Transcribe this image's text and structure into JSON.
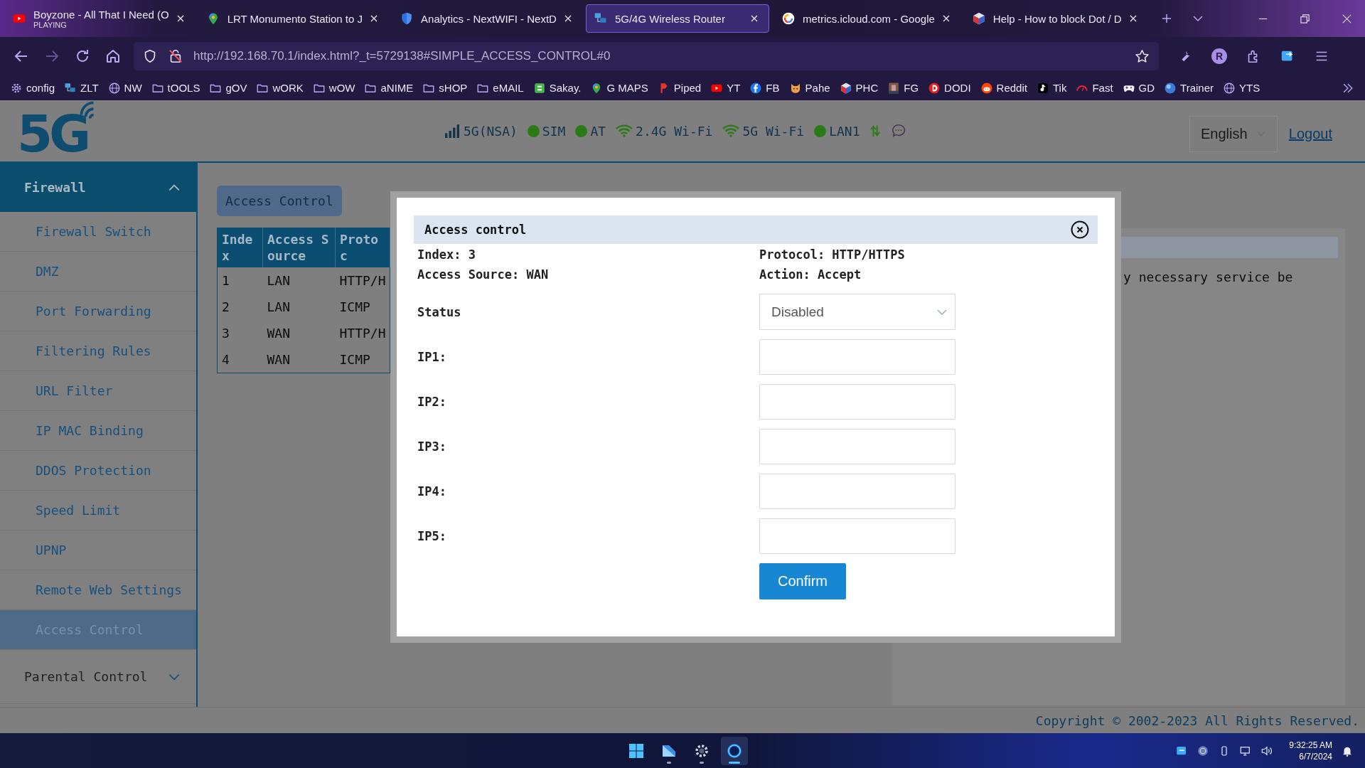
{
  "browser": {
    "tabs": [
      {
        "title": "Boyzone - All That I Need (O",
        "subtitle": "PLAYING",
        "selected": false
      },
      {
        "title": "LRT Monumento Station to J",
        "selected": false
      },
      {
        "title": "Analytics - NextWIFI - NextD",
        "selected": false
      },
      {
        "title": "5G/4G Wireless Router",
        "selected": true
      },
      {
        "title": "metrics.icloud.com - Google",
        "selected": false
      },
      {
        "title": "Help - How to block Dot / D",
        "selected": false
      }
    ],
    "nav": [
      {
        "kind": "back",
        "disabled": false
      },
      {
        "kind": "forward",
        "disabled": true
      },
      {
        "kind": "reload",
        "disabled": false
      },
      {
        "kind": "home",
        "disabled": false
      }
    ],
    "url": "http://192.168.70.1/index.html?_t=5729138#SIMPLE_ACCESS_CONTROL#0",
    "profile": "R",
    "bookmarks": [
      "config",
      "ZLT",
      "NW",
      "tOOLS",
      "gOV",
      "wORK",
      "wOW",
      "aNIME",
      "sHOP",
      "eMAIL",
      "Sakay.",
      "G MAPS",
      "Piped",
      "YT",
      "FB",
      "Pahe",
      "PHC",
      "FG",
      "DODI",
      "Reddit",
      "Tik",
      "Fast",
      "GD",
      "Trainer",
      "YTS"
    ]
  },
  "router": {
    "logo": "5G",
    "status": [
      {
        "kind": "signal",
        "label": "5G(NSA)"
      },
      {
        "kind": "dot",
        "label": "SIM"
      },
      {
        "kind": "dot",
        "label": "AT"
      },
      {
        "kind": "wifi",
        "label": "2.4G Wi-Fi"
      },
      {
        "kind": "wifi",
        "label": "5G Wi-Fi"
      },
      {
        "kind": "dot",
        "label": "LAN1"
      },
      {
        "kind": "arrows"
      },
      {
        "kind": "chat"
      }
    ],
    "language": "English",
    "logout": "Logout"
  },
  "sidebar": {
    "groups": [
      {
        "label": "Firewall",
        "expanded": true,
        "children": [
          {
            "label": "Firewall Switch",
            "selected": false
          },
          {
            "label": "DMZ",
            "selected": false
          },
          {
            "label": "Port Forwarding",
            "selected": false
          },
          {
            "label": "Filtering Rules",
            "selected": false
          },
          {
            "label": "URL Filter",
            "selected": false
          },
          {
            "label": "IP MAC Binding",
            "selected": false
          },
          {
            "label": "DDOS Protection",
            "selected": false
          },
          {
            "label": "Speed Limit",
            "selected": false
          },
          {
            "label": "UPNP",
            "selected": false
          },
          {
            "label": "Remote Web Settings",
            "selected": false
          },
          {
            "label": "Access Control",
            "selected": true
          }
        ]
      },
      {
        "label": "Parental Control",
        "expanded": false
      }
    ]
  },
  "content": {
    "section_button": "Access Control",
    "table": {
      "columns": [
        "Index",
        "Access Source",
        "Protoc"
      ],
      "rows": [
        [
          "1",
          "LAN",
          "HTTP/H"
        ],
        [
          "2",
          "LAN",
          "ICMP"
        ],
        [
          "3",
          "WAN",
          "HTTP/H"
        ],
        [
          "4",
          "WAN",
          "ICMP"
        ]
      ]
    },
    "panel_text": "y necessary service be"
  },
  "modal": {
    "title": "Access control",
    "info": [
      "Index: 3",
      "Protocol: HTTP/HTTPS",
      "Access Source: WAN",
      "Action: Accept"
    ],
    "fields": [
      {
        "label": "Status",
        "kind": "select",
        "value": "Disabled"
      },
      {
        "label": "IP1:",
        "kind": "input"
      },
      {
        "label": "IP2:",
        "kind": "input"
      },
      {
        "label": "IP3:",
        "kind": "input"
      },
      {
        "label": "IP4:",
        "kind": "input"
      },
      {
        "label": "IP5:",
        "kind": "input"
      }
    ],
    "confirm": "Confirm"
  },
  "footer": "Copyright © 2002-2023 All Rights Reserved.",
  "taskbar": {
    "apps": [
      {
        "open": false,
        "active": false
      },
      {
        "open": true,
        "active": false
      },
      {
        "open": true,
        "active": false
      },
      {
        "open": true,
        "active": true
      }
    ],
    "time": "9:32:25 AM",
    "date": "6/7/2024"
  }
}
